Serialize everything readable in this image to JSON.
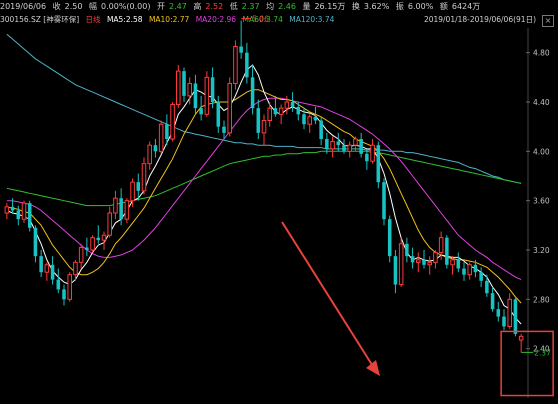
{
  "info": {
    "date": "2019/06/06",
    "close_label": "收",
    "close": "2.50",
    "change_label": "幅",
    "change": "0.00%(0.00)",
    "open_label": "开",
    "open": "2.47",
    "high_label": "高",
    "high": "2.52",
    "low_label": "低",
    "low": "2.37",
    "volume_label": "均",
    "volume": "2.46",
    "amount_label": "量",
    "amount": "26.15万",
    "turnover_label": "换",
    "turnover": "3.62%",
    "amplitude_label": "振",
    "amplitude": "6.00%",
    "value_label": "额",
    "value": "6424万",
    "range": "2019/01/18-2019/06/06(91日)"
  },
  "legend": {
    "symbol": "300156.SZ [神雾环保]",
    "period": "日线",
    "ma5": "MA5:2.58",
    "ma10": "MA10:2.77",
    "ma20": "MA20:2.96",
    "ma60": "MA60:3.74",
    "ma120": "MA120:3.74"
  },
  "colors": {
    "up": "#ff3b3b",
    "down": "#19c3c3",
    "ma5": "#ffffff",
    "ma10": "#f0c419",
    "ma20": "#e040e0",
    "ma60": "#2fc12f",
    "ma120": "#4fb3c8",
    "arrow": "#e8433a"
  },
  "chart_data": {
    "type": "candlestick",
    "ylim": [
      2.0,
      5.0
    ],
    "yticks": [
      "4.80",
      "4.40",
      "4.00",
      "3.60",
      "3.20",
      "2.80",
      "2.40"
    ],
    "ytick_values": [
      4.8,
      4.4,
      4.0,
      3.6,
      3.2,
      2.8,
      2.4
    ],
    "annotations": {
      "high": "5.06",
      "low": "2.37"
    },
    "ohlc": [
      [
        3.5,
        3.58,
        3.45,
        3.55
      ],
      [
        3.55,
        3.62,
        3.5,
        3.52
      ],
      [
        3.52,
        3.56,
        3.4,
        3.45
      ],
      [
        3.45,
        3.6,
        3.42,
        3.58
      ],
      [
        3.58,
        3.6,
        3.35,
        3.38
      ],
      [
        3.38,
        3.4,
        3.1,
        3.15
      ],
      [
        3.15,
        3.2,
        2.98,
        3.02
      ],
      [
        3.02,
        3.1,
        2.95,
        3.08
      ],
      [
        3.08,
        3.15,
        2.92,
        2.96
      ],
      [
        2.96,
        3.05,
        2.85,
        2.88
      ],
      [
        2.88,
        2.92,
        2.75,
        2.8
      ],
      [
        2.8,
        3.02,
        2.78,
        3.0
      ],
      [
        3.0,
        3.12,
        2.95,
        3.1
      ],
      [
        3.1,
        3.25,
        3.05,
        3.22
      ],
      [
        3.22,
        3.3,
        3.15,
        3.2
      ],
      [
        3.2,
        3.32,
        3.18,
        3.3
      ],
      [
        3.3,
        3.4,
        3.25,
        3.28
      ],
      [
        3.28,
        3.35,
        3.2,
        3.32
      ],
      [
        3.32,
        3.55,
        3.3,
        3.5
      ],
      [
        3.5,
        3.68,
        3.45,
        3.62
      ],
      [
        3.62,
        3.7,
        3.4,
        3.45
      ],
      [
        3.45,
        3.62,
        3.42,
        3.6
      ],
      [
        3.6,
        3.78,
        3.55,
        3.75
      ],
      [
        3.75,
        3.82,
        3.6,
        3.68
      ],
      [
        3.68,
        3.95,
        3.65,
        3.9
      ],
      [
        3.9,
        4.08,
        3.85,
        4.05
      ],
      [
        4.05,
        4.1,
        3.95,
        4.0
      ],
      [
        4.0,
        4.25,
        3.98,
        4.22
      ],
      [
        4.22,
        4.3,
        4.05,
        4.1
      ],
      [
        4.1,
        4.4,
        4.08,
        4.38
      ],
      [
        4.38,
        4.7,
        4.35,
        4.65
      ],
      [
        4.65,
        4.68,
        4.4,
        4.45
      ],
      [
        4.45,
        4.6,
        4.38,
        4.55
      ],
      [
        4.55,
        4.62,
        4.3,
        4.35
      ],
      [
        4.35,
        4.45,
        4.25,
        4.3
      ],
      [
        4.3,
        4.65,
        4.28,
        4.6
      ],
      [
        4.6,
        4.68,
        4.35,
        4.4
      ],
      [
        4.4,
        4.45,
        4.15,
        4.2
      ],
      [
        4.2,
        4.25,
        4.1,
        4.15
      ],
      [
        4.15,
        4.6,
        4.12,
        4.55
      ],
      [
        4.55,
        4.9,
        4.5,
        4.85
      ],
      [
        4.85,
        5.06,
        4.75,
        4.8
      ],
      [
        4.8,
        4.88,
        4.55,
        4.6
      ],
      [
        4.6,
        4.7,
        4.3,
        4.35
      ],
      [
        4.35,
        4.42,
        4.1,
        4.15
      ],
      [
        4.15,
        4.3,
        4.05,
        4.25
      ],
      [
        4.25,
        4.4,
        4.2,
        4.35
      ],
      [
        4.35,
        4.45,
        4.28,
        4.3
      ],
      [
        4.3,
        4.38,
        4.22,
        4.35
      ],
      [
        4.35,
        4.45,
        4.3,
        4.4
      ],
      [
        4.4,
        4.48,
        4.32,
        4.36
      ],
      [
        4.36,
        4.4,
        4.25,
        4.3
      ],
      [
        4.3,
        4.35,
        4.18,
        4.22
      ],
      [
        4.22,
        4.3,
        4.15,
        4.28
      ],
      [
        4.28,
        4.36,
        4.22,
        4.25
      ],
      [
        4.25,
        4.28,
        4.05,
        4.1
      ],
      [
        4.1,
        4.15,
        3.98,
        4.02
      ],
      [
        4.02,
        4.12,
        3.95,
        4.08
      ],
      [
        4.08,
        4.15,
        4.0,
        4.05
      ],
      [
        4.05,
        4.1,
        3.98,
        4.0
      ],
      [
        4.0,
        4.08,
        3.95,
        4.05
      ],
      [
        4.05,
        4.12,
        4.0,
        4.1
      ],
      [
        4.1,
        4.15,
        3.95,
        3.98
      ],
      [
        3.98,
        4.02,
        3.85,
        3.92
      ],
      [
        3.92,
        4.1,
        3.9,
        4.05
      ],
      [
        4.05,
        4.08,
        3.7,
        3.75
      ],
      [
        3.75,
        3.78,
        3.4,
        3.45
      ],
      [
        3.45,
        3.48,
        3.1,
        3.15
      ],
      [
        3.15,
        3.2,
        2.85,
        2.92
      ],
      [
        2.92,
        3.3,
        2.9,
        3.25
      ],
      [
        3.25,
        3.3,
        3.1,
        3.15
      ],
      [
        3.15,
        3.22,
        3.05,
        3.1
      ],
      [
        3.1,
        3.18,
        3.02,
        3.12
      ],
      [
        3.12,
        3.2,
        3.05,
        3.08
      ],
      [
        3.08,
        3.15,
        3.0,
        3.1
      ],
      [
        3.1,
        3.2,
        3.05,
        3.18
      ],
      [
        3.18,
        3.35,
        3.12,
        3.3
      ],
      [
        3.3,
        3.32,
        3.05,
        3.08
      ],
      [
        3.08,
        3.15,
        3.0,
        3.12
      ],
      [
        3.12,
        3.18,
        3.02,
        3.05
      ],
      [
        3.05,
        3.1,
        2.95,
        3.0
      ],
      [
        3.0,
        3.1,
        2.96,
        3.08
      ],
      [
        3.08,
        3.12,
        2.98,
        3.02
      ],
      [
        3.02,
        3.06,
        2.9,
        2.95
      ],
      [
        2.95,
        3.0,
        2.82,
        2.85
      ],
      [
        2.85,
        2.9,
        2.7,
        2.72
      ],
      [
        2.72,
        2.78,
        2.62,
        2.66
      ],
      [
        2.66,
        2.72,
        2.55,
        2.58
      ],
      [
        2.58,
        2.85,
        2.56,
        2.8
      ],
      [
        2.8,
        2.82,
        2.5,
        2.52
      ],
      [
        2.47,
        2.52,
        2.37,
        2.5
      ]
    ],
    "ma5": [
      3.52,
      3.5,
      3.49,
      3.47,
      3.45,
      3.35,
      3.25,
      3.12,
      3.03,
      2.98,
      2.94,
      2.92,
      2.96,
      3.04,
      3.1,
      3.18,
      3.24,
      3.26,
      3.34,
      3.42,
      3.45,
      3.52,
      3.6,
      3.62,
      3.68,
      3.8,
      3.88,
      3.97,
      4.07,
      4.16,
      4.3,
      4.36,
      4.43,
      4.5,
      4.48,
      4.45,
      4.44,
      4.38,
      4.33,
      4.36,
      4.45,
      4.56,
      4.66,
      4.7,
      4.62,
      4.48,
      4.38,
      4.32,
      4.3,
      4.34,
      4.36,
      4.34,
      4.32,
      4.31,
      4.29,
      4.23,
      4.17,
      4.13,
      4.1,
      4.05,
      4.04,
      4.05,
      4.04,
      4.02,
      4.02,
      3.94,
      3.82,
      3.66,
      3.46,
      3.3,
      3.18,
      3.12,
      3.14,
      3.12,
      3.11,
      3.12,
      3.16,
      3.15,
      3.14,
      3.14,
      3.11,
      3.07,
      3.05,
      3.02,
      2.98,
      2.9,
      2.84,
      2.75,
      2.72,
      2.65,
      2.6
    ],
    "ma10": [
      3.55,
      3.54,
      3.53,
      3.51,
      3.5,
      3.45,
      3.4,
      3.32,
      3.24,
      3.18,
      3.12,
      3.06,
      3.02,
      3.0,
      3.0,
      3.02,
      3.05,
      3.1,
      3.17,
      3.25,
      3.3,
      3.36,
      3.42,
      3.48,
      3.54,
      3.62,
      3.7,
      3.78,
      3.86,
      3.94,
      4.04,
      4.14,
      4.22,
      4.3,
      4.36,
      4.38,
      4.39,
      4.4,
      4.4,
      4.4,
      4.42,
      4.45,
      4.48,
      4.5,
      4.5,
      4.48,
      4.46,
      4.44,
      4.42,
      4.42,
      4.41,
      4.38,
      4.35,
      4.32,
      4.3,
      4.28,
      4.25,
      4.22,
      4.19,
      4.16,
      4.14,
      4.1,
      4.08,
      4.06,
      4.04,
      4.0,
      3.94,
      3.86,
      3.76,
      3.66,
      3.56,
      3.46,
      3.36,
      3.28,
      3.22,
      3.18,
      3.16,
      3.14,
      3.13,
      3.12,
      3.12,
      3.11,
      3.1,
      3.08,
      3.06,
      3.02,
      2.98,
      2.93,
      2.88,
      2.82,
      2.77
    ],
    "ma20": [
      3.6,
      3.6,
      3.59,
      3.58,
      3.57,
      3.55,
      3.52,
      3.48,
      3.44,
      3.4,
      3.36,
      3.32,
      3.28,
      3.24,
      3.2,
      3.17,
      3.15,
      3.14,
      3.14,
      3.15,
      3.16,
      3.18,
      3.2,
      3.24,
      3.28,
      3.33,
      3.38,
      3.44,
      3.5,
      3.56,
      3.62,
      3.68,
      3.74,
      3.8,
      3.86,
      3.92,
      3.98,
      4.04,
      4.1,
      4.16,
      4.22,
      4.28,
      4.33,
      4.37,
      4.4,
      4.42,
      4.43,
      4.43,
      4.43,
      4.42,
      4.41,
      4.4,
      4.39,
      4.38,
      4.37,
      4.36,
      4.34,
      4.32,
      4.3,
      4.28,
      4.26,
      4.23,
      4.2,
      4.17,
      4.14,
      4.1,
      4.06,
      4.02,
      3.97,
      3.92,
      3.86,
      3.8,
      3.74,
      3.68,
      3.62,
      3.56,
      3.5,
      3.44,
      3.38,
      3.32,
      3.28,
      3.24,
      3.2,
      3.17,
      3.14,
      3.1,
      3.07,
      3.04,
      3.01,
      2.98,
      2.96
    ],
    "ma60": [
      3.7,
      3.69,
      3.68,
      3.67,
      3.66,
      3.65,
      3.64,
      3.63,
      3.62,
      3.61,
      3.6,
      3.59,
      3.58,
      3.57,
      3.56,
      3.56,
      3.56,
      3.56,
      3.56,
      3.57,
      3.58,
      3.59,
      3.6,
      3.61,
      3.62,
      3.63,
      3.64,
      3.66,
      3.68,
      3.7,
      3.72,
      3.74,
      3.76,
      3.78,
      3.8,
      3.82,
      3.84,
      3.86,
      3.88,
      3.9,
      3.91,
      3.92,
      3.93,
      3.94,
      3.95,
      3.96,
      3.96,
      3.97,
      3.97,
      3.98,
      3.98,
      3.98,
      3.99,
      3.99,
      3.99,
      4.0,
      4.0,
      4.0,
      4.0,
      4.0,
      4.0,
      4.0,
      4.0,
      4.0,
      3.99,
      3.99,
      3.98,
      3.97,
      3.96,
      3.95,
      3.94,
      3.93,
      3.92,
      3.91,
      3.9,
      3.89,
      3.88,
      3.87,
      3.86,
      3.85,
      3.84,
      3.83,
      3.82,
      3.81,
      3.8,
      3.79,
      3.78,
      3.77,
      3.76,
      3.75,
      3.74
    ],
    "ma120": [
      4.95,
      4.91,
      4.87,
      4.83,
      4.79,
      4.75,
      4.72,
      4.69,
      4.66,
      4.63,
      4.6,
      4.57,
      4.54,
      4.52,
      4.5,
      4.48,
      4.46,
      4.44,
      4.42,
      4.4,
      4.38,
      4.36,
      4.34,
      4.32,
      4.3,
      4.28,
      4.26,
      4.24,
      4.22,
      4.2,
      4.18,
      4.16,
      4.15,
      4.14,
      4.13,
      4.12,
      4.11,
      4.1,
      4.09,
      4.08,
      4.07,
      4.07,
      4.06,
      4.06,
      4.05,
      4.05,
      4.05,
      4.04,
      4.04,
      4.04,
      4.04,
      4.03,
      4.03,
      4.03,
      4.03,
      4.03,
      4.02,
      4.02,
      4.02,
      4.02,
      4.02,
      4.02,
      4.02,
      4.01,
      4.01,
      4.01,
      4.01,
      4.0,
      4.0,
      4.0,
      3.99,
      3.99,
      3.98,
      3.97,
      3.96,
      3.95,
      3.94,
      3.93,
      3.92,
      3.91,
      3.89,
      3.87,
      3.86,
      3.84,
      3.82,
      3.8,
      3.79,
      3.77,
      3.76,
      3.75,
      3.74
    ]
  }
}
